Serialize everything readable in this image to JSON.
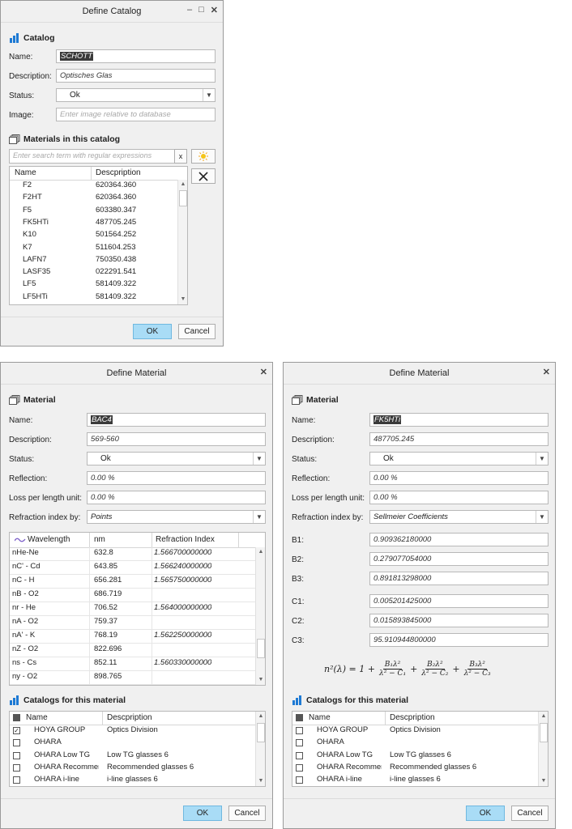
{
  "catalog_dialog": {
    "title": "Define Catalog",
    "section_title": "Catalog",
    "name_label": "Name:",
    "name_value": "SCHOTT",
    "description_label": "Description:",
    "description_value": "Optisches Glas",
    "status_label": "Status:",
    "status_value": "Ok",
    "image_label": "Image:",
    "image_placeholder": "Enter image relative to database",
    "materials_title": "Materials in this catalog",
    "search_placeholder": "Enter search term with regular expressions",
    "search_clear": "x",
    "columns": [
      "Name",
      "Descpription"
    ],
    "rows": [
      {
        "name": "F2",
        "desc": "620364.360"
      },
      {
        "name": "F2HT",
        "desc": "620364.360"
      },
      {
        "name": "F5",
        "desc": "603380.347"
      },
      {
        "name": "FK5HTi",
        "desc": "487705.245"
      },
      {
        "name": "K10",
        "desc": "501564.252"
      },
      {
        "name": "K7",
        "desc": "511604.253"
      },
      {
        "name": "LAFN7",
        "desc": "750350.438"
      },
      {
        "name": "LASF35",
        "desc": "022291.541"
      },
      {
        "name": "LF5",
        "desc": "581409.322"
      },
      {
        "name": "LF5HTi",
        "desc": "581409.322"
      }
    ],
    "ok_label": "OK",
    "cancel_label": "Cancel"
  },
  "material_dialog_left": {
    "title": "Define Material",
    "section_title": "Material",
    "name_label": "Name:",
    "name_value": "BAC4",
    "description_label": "Description:",
    "description_value": "569-560",
    "status_label": "Status:",
    "status_value": "Ok",
    "reflection_label": "Reflection:",
    "reflection_value": "0.00 %",
    "loss_label": "Loss per length unit:",
    "loss_value": "0.00 %",
    "refraction_label": "Refraction index by:",
    "refraction_value": "Points",
    "columns": [
      "Wavelength",
      "nm",
      "Refraction Index"
    ],
    "rows": [
      {
        "wl": "nHe-Ne",
        "nm": "632.8",
        "ri": "1.566700000000"
      },
      {
        "wl": "nC' - Cd",
        "nm": "643.85",
        "ri": "1.566240000000"
      },
      {
        "wl": "nC - H",
        "nm": "656.281",
        "ri": "1.565750000000"
      },
      {
        "wl": "nB - O2",
        "nm": "686.719",
        "ri": ""
      },
      {
        "wl": "nr - He",
        "nm": "706.52",
        "ri": "1.564000000000"
      },
      {
        "wl": "nA - O2",
        "nm": "759.37",
        "ri": ""
      },
      {
        "wl": "nA' - K",
        "nm": "768.19",
        "ri": "1.562250000000"
      },
      {
        "wl": "nZ - O2",
        "nm": "822.696",
        "ri": ""
      },
      {
        "wl": "ns - Cs",
        "nm": "852.11",
        "ri": "1.560330000000"
      },
      {
        "wl": "ny - O2",
        "nm": "898.765",
        "ri": ""
      }
    ],
    "catalogs_title": "Catalogs for this material",
    "catalog_columns": [
      "Name",
      "Descpription"
    ],
    "catalogs": [
      {
        "name": "HOYA GROUP",
        "desc": "Optics Division",
        "checked": true
      },
      {
        "name": "OHARA",
        "desc": "",
        "checked": false
      },
      {
        "name": "OHARA Low TG",
        "desc": "Low TG glasses 6",
        "checked": false
      },
      {
        "name": "OHARA Recommended",
        "desc": "Recommended glasses 6",
        "checked": false
      },
      {
        "name": "OHARA i-line",
        "desc": "i-line glasses 6",
        "checked": false
      }
    ],
    "ok_label": "OK",
    "cancel_label": "Cancel"
  },
  "material_dialog_right": {
    "title": "Define Material",
    "section_title": "Material",
    "name_label": "Name:",
    "name_value": "FK5HTi",
    "description_label": "Description:",
    "description_value": "487705.245",
    "status_label": "Status:",
    "status_value": "Ok",
    "reflection_label": "Reflection:",
    "reflection_value": "0.00 %",
    "loss_label": "Loss per length unit:",
    "loss_value": "0.00 %",
    "refraction_label": "Refraction index by:",
    "refraction_value": "Sellmeier Coefficients",
    "coefficients": [
      {
        "label": "B1:",
        "value": "0.909362180000"
      },
      {
        "label": "B2:",
        "value": "0.279077054000"
      },
      {
        "label": "B3:",
        "value": "0.891813298000"
      },
      {
        "label": "C1:",
        "value": "0.005201425000"
      },
      {
        "label": "C2:",
        "value": "0.015893845000"
      },
      {
        "label": "C3:",
        "value": "95.910944800000"
      }
    ],
    "catalogs_title": "Catalogs for this material",
    "catalog_columns": [
      "Name",
      "Descpription"
    ],
    "catalogs": [
      {
        "name": "HOYA GROUP",
        "desc": "Optics Division",
        "checked": false
      },
      {
        "name": "OHARA",
        "desc": "",
        "checked": false
      },
      {
        "name": "OHARA Low TG",
        "desc": "Low TG glasses 6",
        "checked": false
      },
      {
        "name": "OHARA Recommended",
        "desc": "Recommended glasses 6",
        "checked": false
      },
      {
        "name": "OHARA i-line",
        "desc": "i-line glasses 6",
        "checked": false
      }
    ],
    "ok_label": "OK",
    "cancel_label": "Cancel"
  },
  "icons": {
    "catalog": "bar-chart-icon",
    "material": "layers-icon",
    "wavelength": "wave-icon",
    "add": "sun-add-icon",
    "delete": "cross-delete-icon"
  },
  "colors": {
    "primary_button": "#a9dcf6",
    "catalog_icon": "#1e7ad4",
    "wave_icon": "#7a5cc8"
  }
}
